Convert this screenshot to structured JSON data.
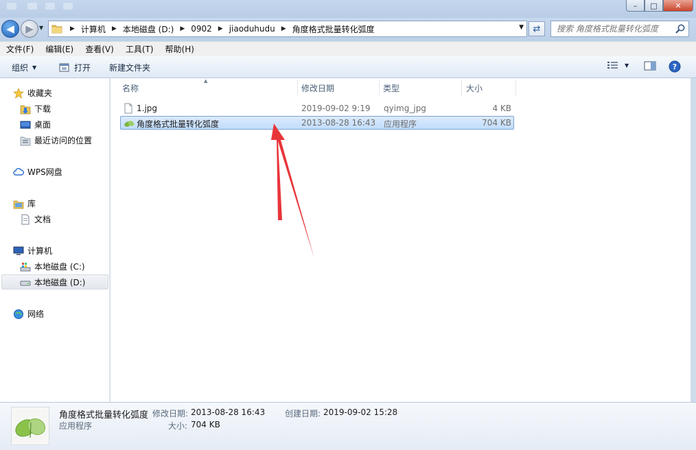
{
  "window": {
    "controls": {
      "minimize": "–",
      "maximize": "□",
      "close": "✕"
    }
  },
  "address": {
    "crumbs": [
      "计算机",
      "本地磁盘 (D:)",
      "0902",
      "jiaoduhudu",
      "角度格式批量转化弧度"
    ]
  },
  "search": {
    "placeholder": "搜索 角度格式批量转化弧度"
  },
  "menu": [
    "文件(F)",
    "编辑(E)",
    "查看(V)",
    "工具(T)",
    "帮助(H)"
  ],
  "toolbar": {
    "organize": "组织",
    "open": "打开",
    "new_folder": "新建文件夹"
  },
  "nav": {
    "favorites": "收藏夹",
    "downloads": "下载",
    "desktop": "桌面",
    "recent": "最近访问的位置",
    "wps": "WPS网盘",
    "libraries": "库",
    "documents": "文档",
    "computer": "计算机",
    "drive_c": "本地磁盘 (C:)",
    "drive_d": "本地磁盘 (D:)",
    "network": "网络"
  },
  "columns": {
    "name": "名称",
    "date": "修改日期",
    "type": "类型",
    "size": "大小"
  },
  "files": [
    {
      "name": "1.jpg",
      "date": "2019-09-02 9:19",
      "type": "qyimg_jpg",
      "size": "4 KB"
    },
    {
      "name": "角度格式批量转化弧度",
      "date": "2013-08-28 16:43",
      "type": "应用程序",
      "size": "704 KB"
    }
  ],
  "details": {
    "name": "角度格式批量转化弧度",
    "type": "应用程序",
    "modified_label": "修改日期:",
    "modified": "2013-08-28 16:43",
    "created_label": "创建日期:",
    "created": "2019-09-02 15:28",
    "size_label": "大小:",
    "size": "704 KB"
  },
  "colors": {
    "selection": "#c1dcfc",
    "selection_border": "#7da2ce",
    "annotation_arrow": "#e8353a"
  }
}
